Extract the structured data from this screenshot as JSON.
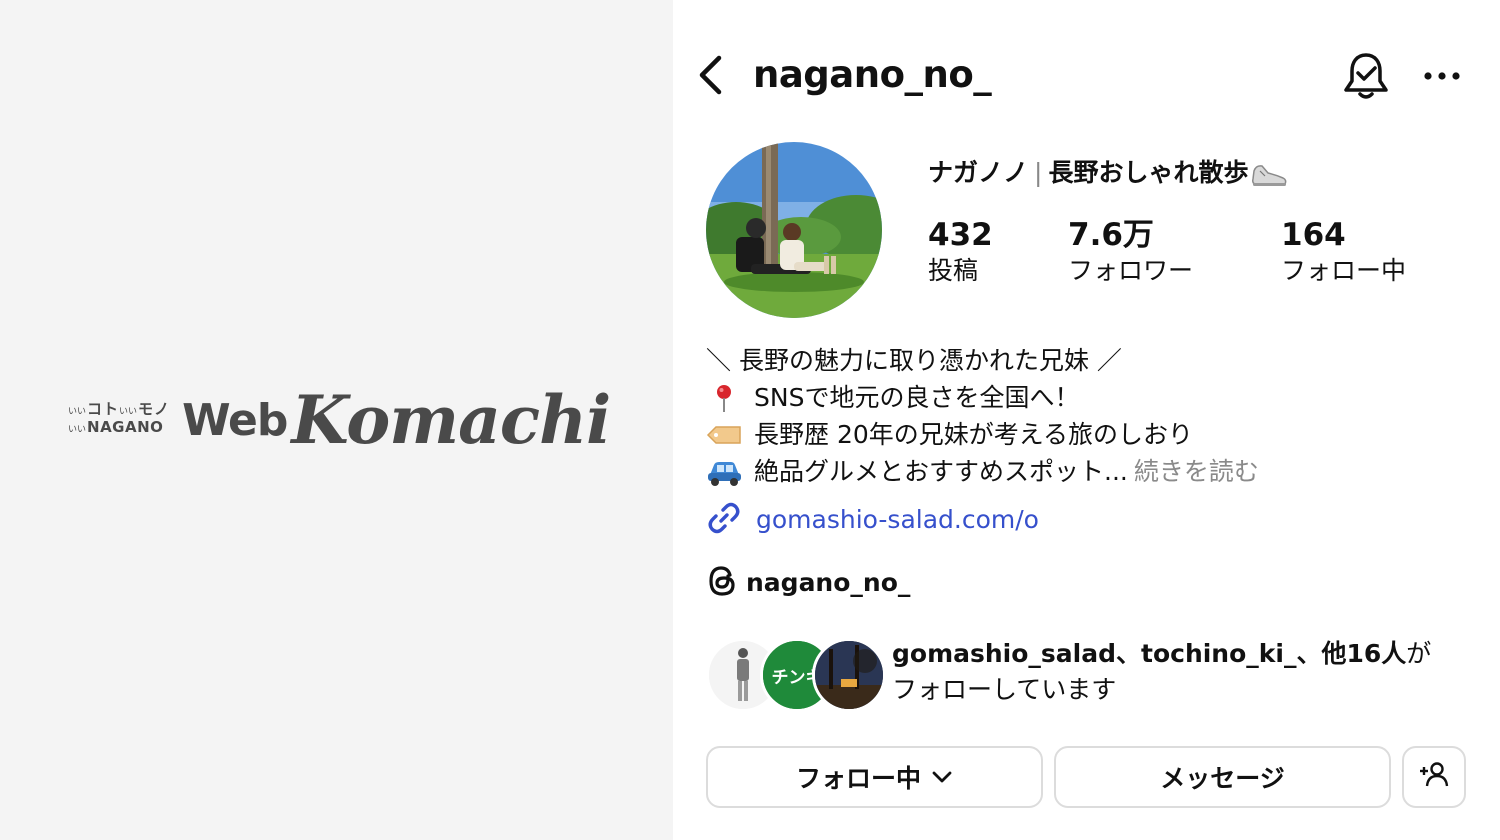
{
  "logo": {
    "small_top": "コト",
    "small_top_suffix": "モノ",
    "small_prefix": "いい",
    "small_bottom": "NAGANO",
    "web": "Web",
    "komachi": "Komachi"
  },
  "header": {
    "username": "nagano_no_"
  },
  "profile": {
    "display_name": "ナガノノ",
    "separator": "|",
    "tagline": "長野おしゃれ散歩",
    "stats": [
      {
        "value": "432",
        "label": "投稿"
      },
      {
        "value": "7.6万",
        "label": "フォロワー"
      },
      {
        "value": "164",
        "label": "フォロー中"
      }
    ],
    "bio": [
      "＼ 長野の魅力に取り憑かれた兄妹 ／",
      "SNSで地元の良さを全国へ！",
      "長野歴 20年の兄妹が考える旅のしおり",
      "絶品グルメとおすすめスポット..."
    ],
    "bio_more": "続きを読む",
    "link": "gomashio-salad.com/o",
    "threads_handle": "nagano_no_",
    "followed_by_names": "gomashio_salad、tochino_ki_、他16人",
    "followed_by_suffix": "が",
    "followed_by_line2": "フォローしています",
    "follower_badge_text": "チンキ"
  },
  "buttons": {
    "following": "フォロー中",
    "message": "メッセージ"
  },
  "colors": {
    "link": "#3650cc",
    "muted": "#8a8a8a",
    "left_bg": "#f4f4f4",
    "logo_gray": "#4a4a4a",
    "badge_green": "#1f8a3a"
  }
}
